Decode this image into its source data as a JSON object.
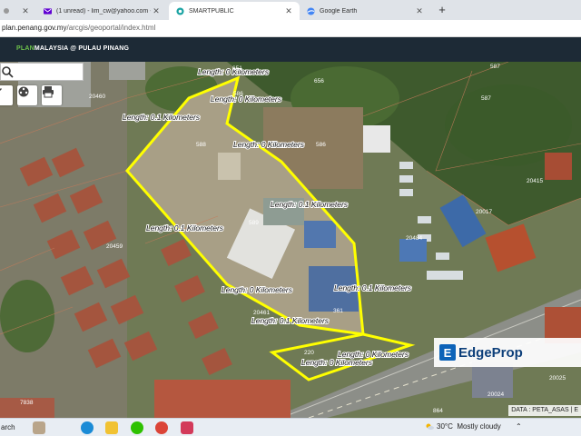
{
  "browser": {
    "tabs": [
      {
        "label": "",
        "icon": "generic-tab-icon",
        "color": "#888888",
        "active": false
      },
      {
        "label": "(1 unread) - lim_cw@yahoo.com - ",
        "icon": "yahoo-mail-icon",
        "color": "#6001d2",
        "active": false
      },
      {
        "label": "SMARTPUBLIC",
        "icon": "smartpublic-icon",
        "color": "#1aa3a3",
        "active": true
      },
      {
        "label": "Google Earth",
        "icon": "google-earth-icon",
        "color": "#4285f4",
        "active": false
      }
    ],
    "new_tab": "+",
    "url_host": "plan.penang.gov.my",
    "url_path": "/arcgis/geoportal/index.html"
  },
  "app": {
    "brand_prefix": "PLAN",
    "brand_rest": "MALAYSIA @ PULAU PINANG",
    "accent": "#6cc04a"
  },
  "map": {
    "boundary_color": "#ffff00",
    "measurements": [
      "Length: 0 Kilometers",
      "Length: 0 Kilometers",
      "Length: 0.1 Kilometers",
      "Length: 0 Kilometers",
      "Length: 0.1 Kilometers",
      "Length: 0.1 Kilometers",
      "Length: 0 Kilometers",
      "Length: 0.1 Kilometers",
      "Length: 0.1 Kilometers",
      "Length: 0 Kilometers",
      "Length: 0 Kilometers"
    ],
    "plot_numbers": [
      "651",
      "656",
      "587",
      "20460",
      "586",
      "586",
      "588",
      "587",
      "589",
      "20415",
      "20017",
      "20459",
      "20484",
      "20461",
      "361",
      "220",
      "20025",
      "7838",
      "20024",
      "864"
    ],
    "watermark": "EdgeProp",
    "credit": "DATA : PETA_ASAS | E"
  },
  "taskbar": {
    "search": "arch",
    "apps": [
      {
        "icon": "photos-icon",
        "color": "#b9a58a"
      },
      {
        "icon": "edge-browser-icon",
        "color": "#1b8bd6"
      },
      {
        "icon": "file-explorer-icon",
        "color": "#f1c232"
      },
      {
        "icon": "wechat-icon",
        "color": "#2dc100"
      },
      {
        "icon": "chrome-icon",
        "color": "#db4437"
      },
      {
        "icon": "vivaldi-icon",
        "color": "#d33a5a"
      }
    ],
    "weather_temp": "30°C",
    "weather_text": "Mostly cloudy"
  }
}
